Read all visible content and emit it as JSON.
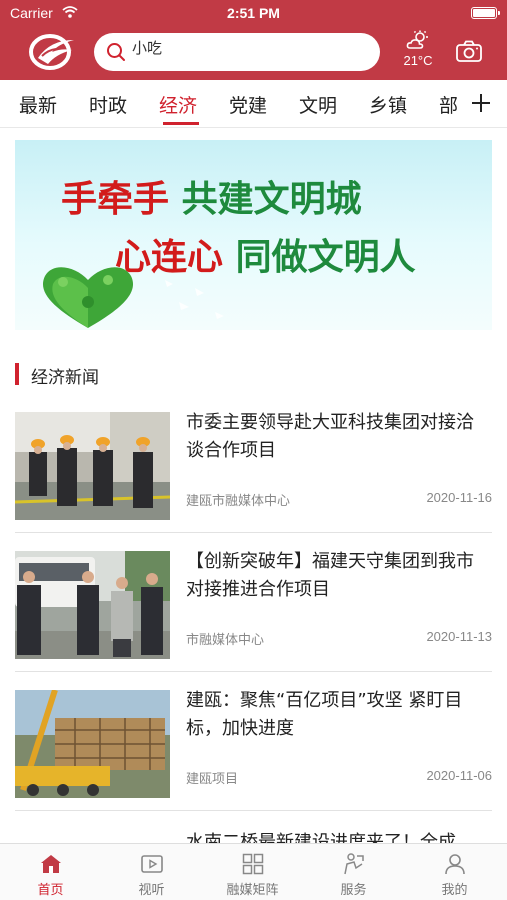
{
  "status_bar": {
    "carrier": "Carrier",
    "time": "2:51 PM"
  },
  "header": {
    "search_value": "小吃",
    "temperature": "21°C",
    "colors": {
      "brand": "#c13a45",
      "accent": "#d0222e"
    }
  },
  "tabs": [
    {
      "label": "最新",
      "active": false
    },
    {
      "label": "时政",
      "active": false
    },
    {
      "label": "经济",
      "active": true
    },
    {
      "label": "党建",
      "active": false
    },
    {
      "label": "文明",
      "active": false
    },
    {
      "label": "乡镇",
      "active": false
    },
    {
      "label": "部",
      "active": false
    }
  ],
  "banner": {
    "line1_red": "手牵手",
    "line1_green": "共建文明城",
    "line2_red": "心连心",
    "line2_green": "同做文明人"
  },
  "section": {
    "title": "经济新闻"
  },
  "news": [
    {
      "title": "市委主要领导赴大亚科技集团对接洽谈合作项目",
      "source": "建瓯市融媒体中心",
      "date": "2020-11-16"
    },
    {
      "title": "【创新突破年】福建天守集团到我市对接推进合作项目",
      "source": "市融媒体中心",
      "date": "2020-11-13"
    },
    {
      "title": "建瓯：聚焦“百亿项目”攻坚 紧盯目标，加快进度",
      "source": "建瓯项目",
      "date": "2020-11-06"
    }
  ],
  "partial_news_title": "水南二桥最新建设进度来了！全成",
  "bottom_nav": [
    {
      "label": "首页",
      "icon": "home-icon",
      "active": true
    },
    {
      "label": "视听",
      "icon": "video-icon",
      "active": false
    },
    {
      "label": "融媒矩阵",
      "icon": "grid-icon",
      "active": false
    },
    {
      "label": "服务",
      "icon": "service-icon",
      "active": false
    },
    {
      "label": "我的",
      "icon": "profile-icon",
      "active": false
    }
  ]
}
